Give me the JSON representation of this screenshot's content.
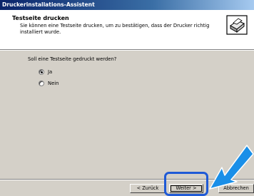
{
  "window": {
    "title": "Druckerinstallations-Assistent"
  },
  "header": {
    "title": "Testseite drucken",
    "description": "Sie können eine Testseite drucken, um zu bestätigen, dass der Drucker richtig installiert wurde."
  },
  "main": {
    "question": "Soll eine Testseite gedruckt werden?",
    "options": [
      {
        "label": "Ja",
        "selected": true
      },
      {
        "label": "Nein",
        "selected": false
      }
    ]
  },
  "buttons": {
    "back": "< Zurück",
    "next": "Weiter >",
    "cancel": "Abbrechen"
  },
  "colors": {
    "highlight": "#1f5ad6",
    "arrow": "#1a8fe8"
  }
}
